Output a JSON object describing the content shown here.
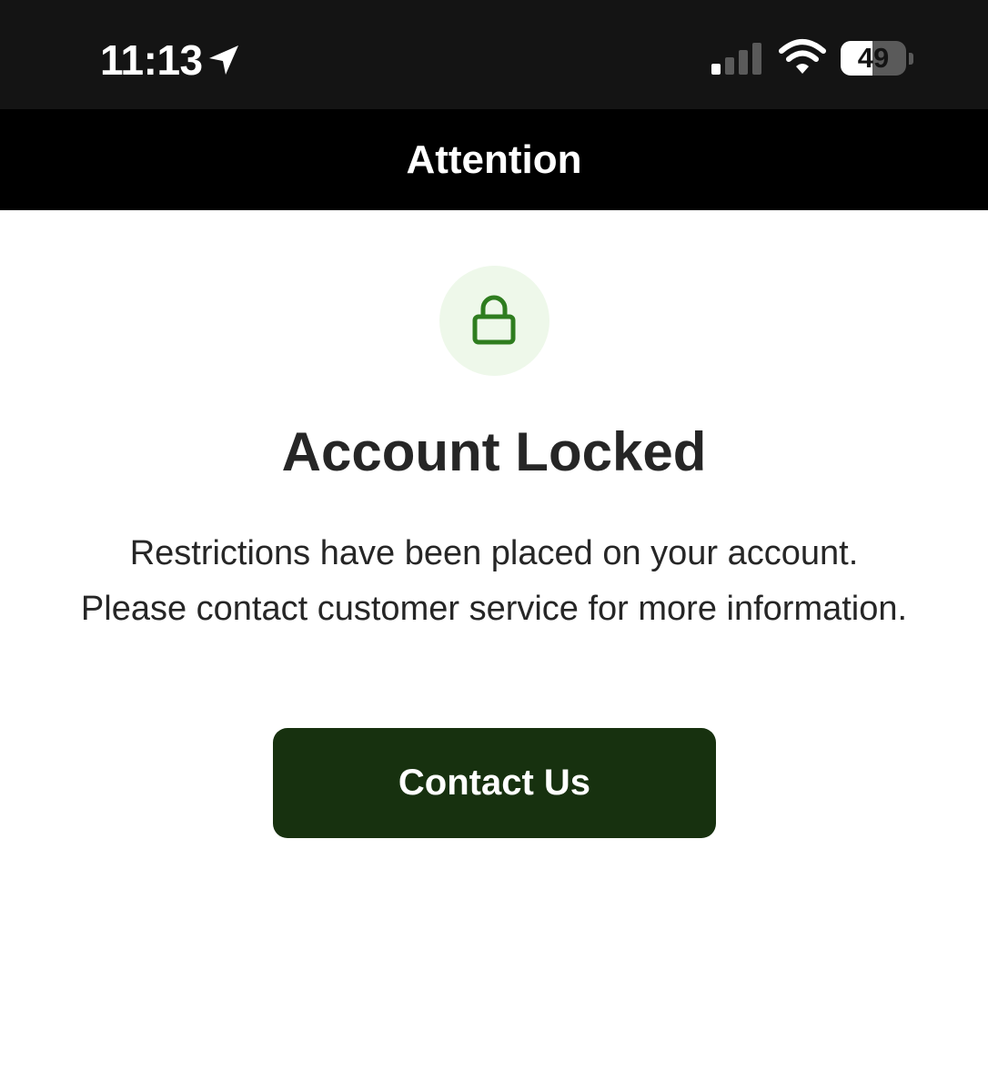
{
  "status_bar": {
    "time": "11:13",
    "battery_level": "49",
    "battery_fraction": 0.49,
    "icons": {
      "location": "location-arrow-icon",
      "signal": "cellular-signal-icon",
      "wifi": "wifi-icon",
      "battery": "battery-icon"
    },
    "signal_bars_active": 1,
    "signal_bars_total": 4
  },
  "nav": {
    "title": "Attention"
  },
  "lock": {
    "icon": "lock-icon",
    "color": "#2e7d1f",
    "background": "#eef8ea"
  },
  "content": {
    "headline": "Account Locked",
    "message": "Restrictions have been placed on your account. Please contact customer service for more information."
  },
  "actions": {
    "contact_label": "Contact Us",
    "contact_color": "#17310f"
  }
}
